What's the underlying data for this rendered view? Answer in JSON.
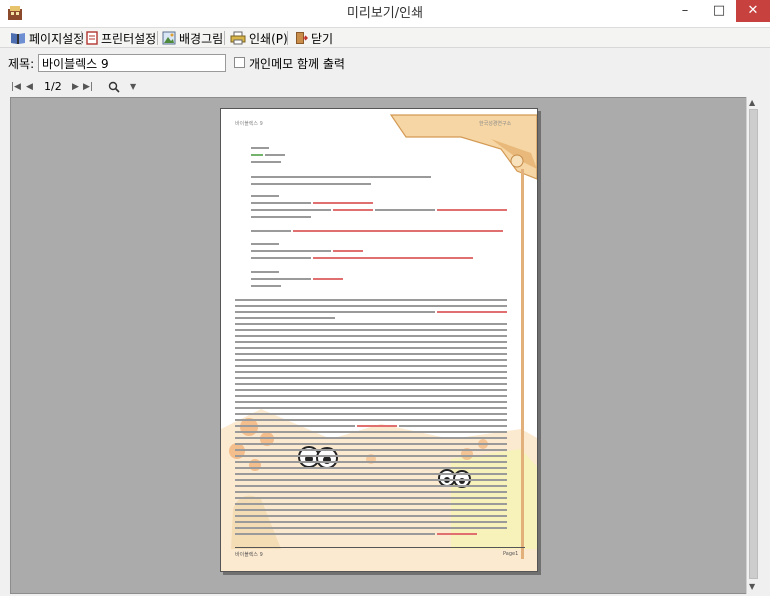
{
  "window": {
    "title": "미리보기/인쇄",
    "minimize": "–",
    "maximize": "□",
    "close": "✕"
  },
  "toolbar": {
    "page_setup": "페이지설정",
    "printer_setup": "프린터설정",
    "background": "배경그림",
    "print": "인쇄(P)",
    "close": "닫기"
  },
  "title_row": {
    "label": "제목:",
    "value": "바이블렉스 9",
    "memo_label": "개인메모 함께 출력",
    "memo_checked": false
  },
  "nav": {
    "page_indicator": "1/2"
  },
  "page": {
    "header_left": "바이블렉스 9",
    "header_right": "한국성경연구소",
    "footer_left": "바이블렉스 9",
    "footer_right": "Page1"
  }
}
